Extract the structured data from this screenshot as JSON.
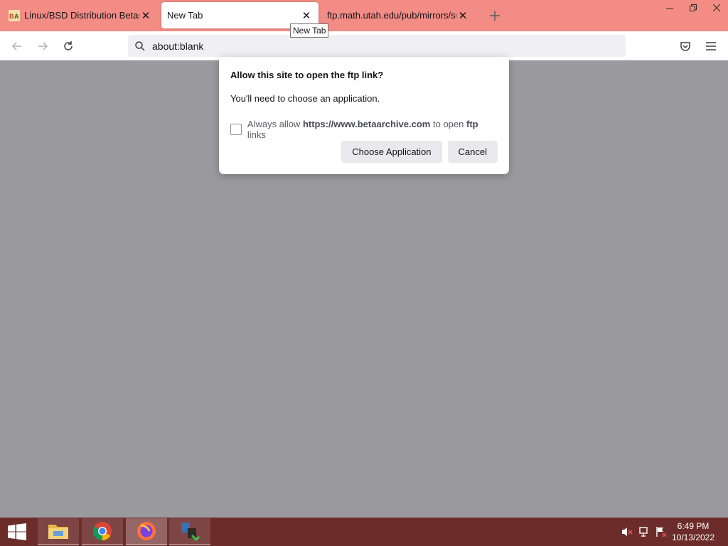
{
  "browser": {
    "tabs": [
      {
        "title": "Linux/BSD Distribution Betas - B",
        "favicon": "betaarchive-favicon",
        "active": false
      },
      {
        "title": "New Tab",
        "favicon": "",
        "active": true
      },
      {
        "title": "ftp.math.utah.edu/pub/mirrors/sun",
        "favicon": "",
        "active": false
      }
    ],
    "tooltip": "New Tab",
    "url": "about:blank"
  },
  "dialog": {
    "title": "Allow this site to open the ftp link?",
    "message": "You'll need to choose an application.",
    "checkbox_prefix": "Always allow",
    "checkbox_site": "https://www.betaarchive.com",
    "checkbox_middle": "to open",
    "checkbox_protocol": "ftp",
    "checkbox_suffix": "links",
    "checkbox_checked": false,
    "choose_button": "Choose Application",
    "cancel_button": "Cancel"
  },
  "taskbar": {
    "apps": [
      "file-explorer-icon",
      "chrome-icon",
      "firefox-icon",
      "network-app-icon"
    ],
    "active_app": "firefox-icon",
    "time": "6:49 PM",
    "date": "10/13/2022"
  },
  "colors": {
    "tabstrip": "#f28c85",
    "taskbar": "#6b2c2a",
    "content_bg": "#9a999d"
  }
}
